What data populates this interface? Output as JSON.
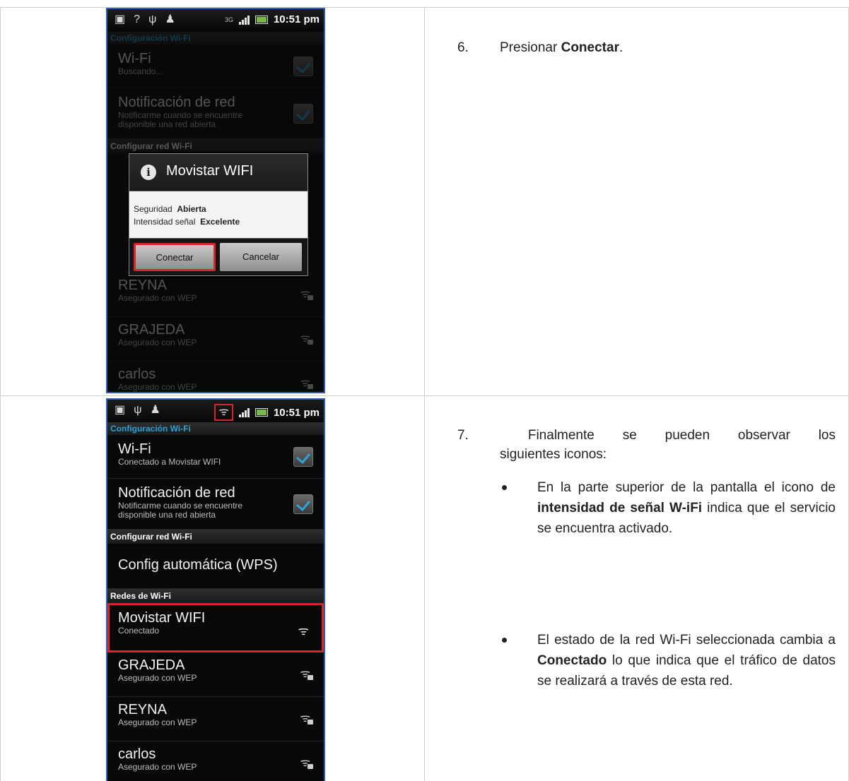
{
  "screen1": {
    "status_time": "10:51 pm",
    "status_network": "3G",
    "section_title": "Configuración Wi-Fi",
    "wifi_title": "Wi-Fi",
    "wifi_sub": "Buscando...",
    "notif_title": "Notificación de red",
    "notif_sub_1": "Notificarme cuando se encuentre",
    "notif_sub_2": "disponible una red abierta",
    "config_header": "Configurar red Wi-Fi",
    "networks": [
      {
        "name": "REYNA",
        "security": "Asegurado con WEP"
      },
      {
        "name": "GRAJEDA",
        "security": "Asegurado con WEP"
      },
      {
        "name": "carlos",
        "security": "Asegurado con WEP"
      }
    ],
    "dialog": {
      "title": "Movistar WIFI",
      "security_label": "Seguridad",
      "security_value": "Abierta",
      "signal_label": "Intensidad señal",
      "signal_value": "Excelente",
      "connect_label": "Conectar",
      "cancel_label": "Cancelar"
    }
  },
  "screen2": {
    "status_time": "10:51 pm",
    "section_title": "Configuración Wi-Fi",
    "wifi_title": "Wi-Fi",
    "wifi_sub": "Conectado a Movistar WIFI",
    "notif_title": "Notificación de red",
    "notif_sub_1": "Notificarme cuando se encuentre",
    "notif_sub_2": "disponible una red abierta",
    "config_header": "Configurar red Wi-Fi",
    "wps_label": "Config automática (WPS)",
    "networks_header": "Redes de Wi-Fi",
    "connected_network": {
      "name": "Movistar WIFI",
      "status": "Conectado"
    },
    "networks": [
      {
        "name": "GRAJEDA",
        "security": "Asegurado con WEP"
      },
      {
        "name": "REYNA",
        "security": "Asegurado con WEP"
      },
      {
        "name": "carlos",
        "security": "Asegurado con WEP"
      }
    ]
  },
  "text": {
    "step6_num": "6.",
    "step6_pre": "Presionar ",
    "step6_bold": "Conectar",
    "step6_post": ".",
    "step7_num": "7.",
    "step7_words": [
      "Finalmente",
      "se",
      "pueden",
      "observar",
      "los"
    ],
    "step7_line2": "siguientes iconos:",
    "bullet1_pre": "En la parte superior de la pantalla el icono de ",
    "bullet1_bold": "intensidad de señal W-iFi",
    "bullet1_post": " indica que el servicio se encuentra activado.",
    "bullet2_pre": "El estado de la red Wi-Fi seleccionada cambia a ",
    "bullet2_bold": "Conectado",
    "bullet2_post": " lo que indica que el tráfico de datos se realizará a través de esta red."
  },
  "colors": {
    "highlight": "#d6252b",
    "accent": "#2da3d8"
  }
}
